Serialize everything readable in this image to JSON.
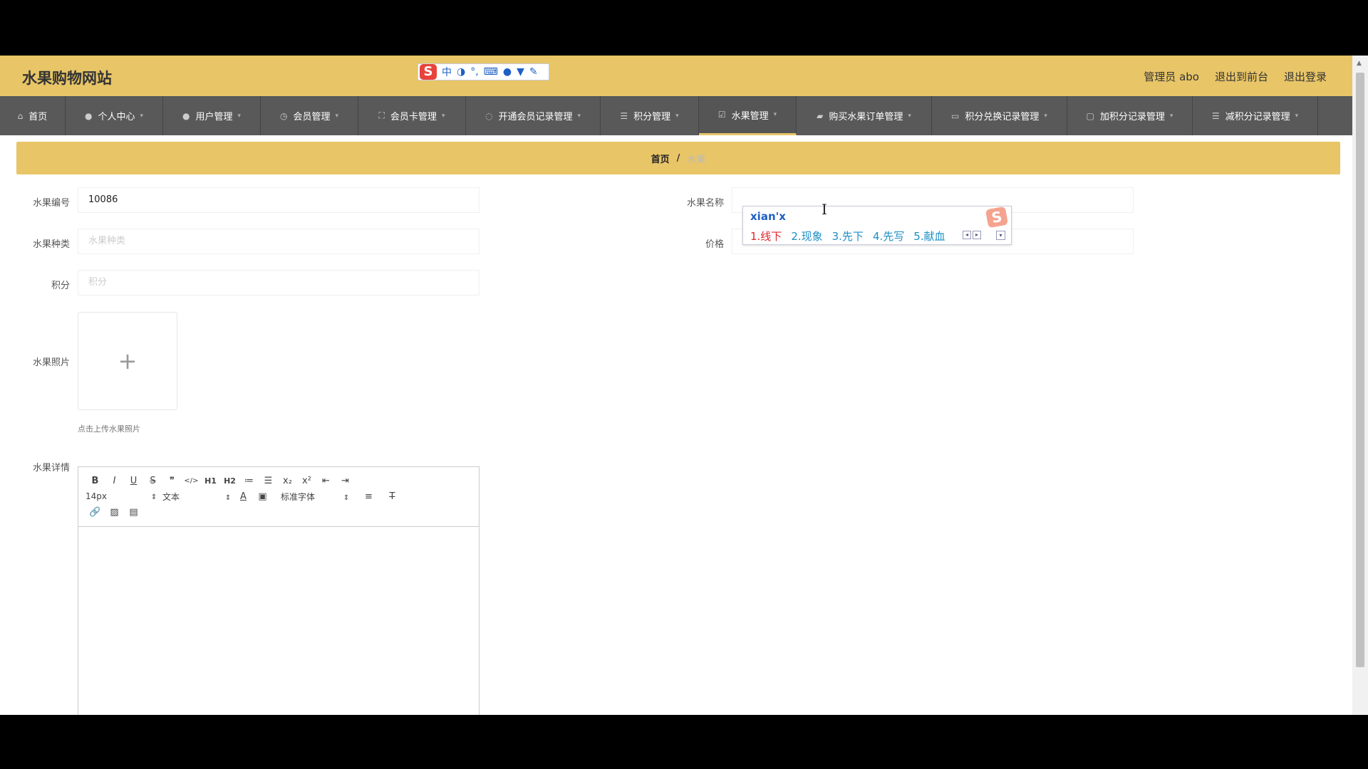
{
  "header": {
    "site_title": "水果购物网站",
    "ime_toolbar": {
      "logo": "S",
      "mode": "中"
    },
    "links": [
      "管理员 abo",
      "退出到前台",
      "退出登录"
    ]
  },
  "nav": {
    "items": [
      {
        "label": "首页",
        "icon": "home-icon",
        "dropdown": false
      },
      {
        "label": "个人中心",
        "icon": "user-icon",
        "dropdown": true
      },
      {
        "label": "用户管理",
        "icon": "user-icon",
        "dropdown": true
      },
      {
        "label": "会员管理",
        "icon": "clock-icon",
        "dropdown": true
      },
      {
        "label": "会员卡管理",
        "icon": "expand-icon",
        "dropdown": true
      },
      {
        "label": "开通会员记录管理",
        "icon": "circle-icon",
        "dropdown": true
      },
      {
        "label": "积分管理",
        "icon": "list-icon",
        "dropdown": true
      },
      {
        "label": "水果管理",
        "icon": "check-icon",
        "dropdown": true,
        "active": true
      },
      {
        "label": "购买水果订单管理",
        "icon": "bag-icon",
        "dropdown": true
      },
      {
        "label": "积分兑换记录管理",
        "icon": "card-icon",
        "dropdown": true
      },
      {
        "label": "加积分记录管理",
        "icon": "chat-icon",
        "dropdown": true
      },
      {
        "label": "减积分记录管理",
        "icon": "list-icon",
        "dropdown": true
      }
    ]
  },
  "breadcrumb": {
    "home": "首页",
    "separator": "/",
    "current": "水果"
  },
  "form": {
    "fruit_no": {
      "label": "水果编号",
      "value": "10086"
    },
    "fruit_name": {
      "label": "水果名称",
      "value": ""
    },
    "fruit_type": {
      "label": "水果种类",
      "placeholder": "水果种类"
    },
    "price": {
      "label": "价格",
      "placeholder": "价格"
    },
    "points": {
      "label": "积分",
      "placeholder": "积分"
    },
    "photo": {
      "label": "水果照片",
      "tip": "点击上传水果照片"
    },
    "details": {
      "label": "水果详情"
    }
  },
  "editor": {
    "row1": [
      "B",
      "I",
      "U",
      "S",
      "❞",
      "</>",
      "H1",
      "H2",
      "ol",
      "ul",
      "x₂",
      "x²",
      "outdent",
      "indent"
    ],
    "font_size": "14px",
    "block_type": "文本",
    "font_family": "标准字体"
  },
  "ime_popup": {
    "composition": "xian'x",
    "candidates": [
      "1.线下",
      "2.现象",
      "3.先下",
      "4.先写",
      "5.献血"
    ]
  }
}
